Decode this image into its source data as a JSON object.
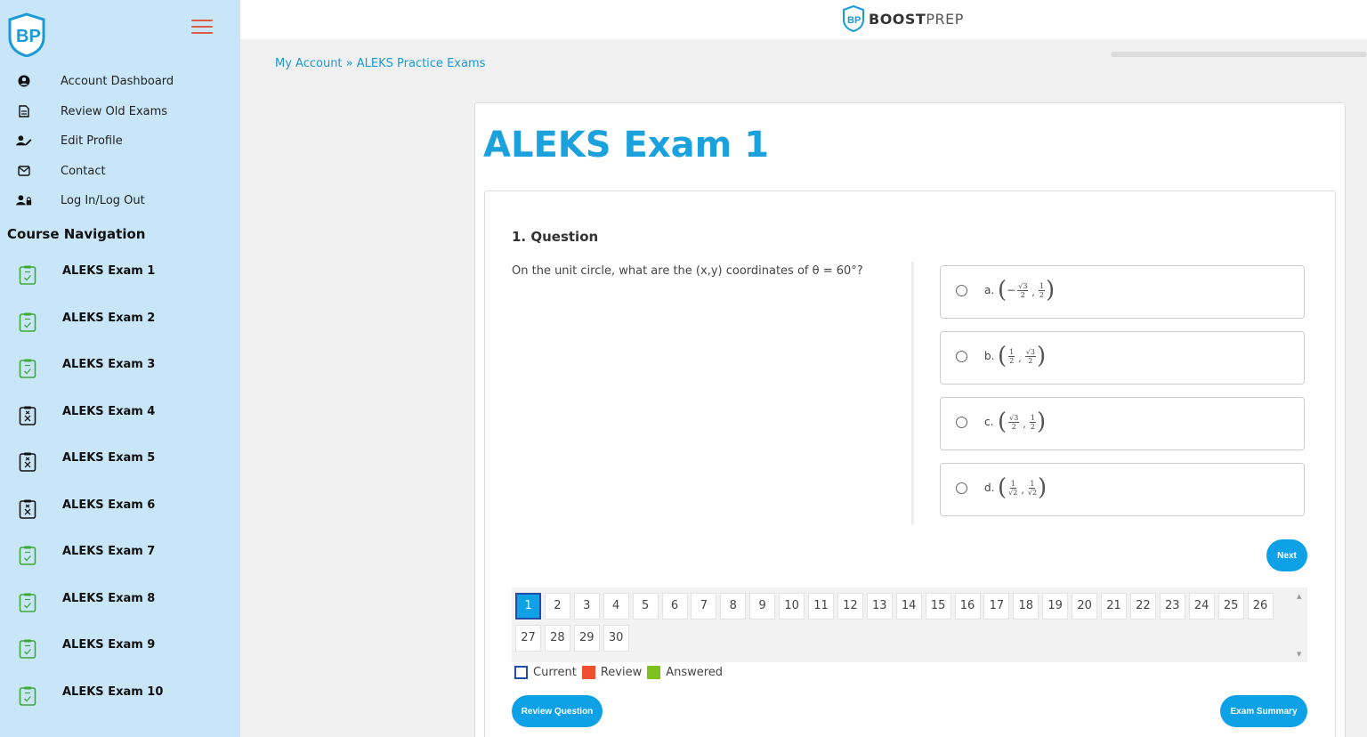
{
  "brand": {
    "name_bold": "BOOST",
    "name_light": "PREP"
  },
  "breadcrumb": {
    "home": "My Account",
    "sep": " » ",
    "current": "ALEKS Practice Exams"
  },
  "sidebar": {
    "menu": [
      {
        "label": "Account Dashboard",
        "icon": "user-circle-icon"
      },
      {
        "label": "Review Old Exams",
        "icon": "document-icon"
      },
      {
        "label": "Edit Profile",
        "icon": "user-edit-icon"
      },
      {
        "label": "Contact",
        "icon": "envelope-icon"
      },
      {
        "label": "Log In/Log Out",
        "icon": "user-lock-icon"
      }
    ],
    "course_nav_title": "Course Navigation",
    "exams": [
      {
        "label": "ALEKS Exam 1",
        "status": "passed"
      },
      {
        "label": "ALEKS Exam 2",
        "status": "passed"
      },
      {
        "label": "ALEKS Exam 3",
        "status": "passed"
      },
      {
        "label": "ALEKS Exam 4",
        "status": "failed"
      },
      {
        "label": "ALEKS Exam 5",
        "status": "failed"
      },
      {
        "label": "ALEKS Exam 6",
        "status": "failed"
      },
      {
        "label": "ALEKS Exam 7",
        "status": "passed"
      },
      {
        "label": "ALEKS Exam 8",
        "status": "passed"
      },
      {
        "label": "ALEKS Exam 9",
        "status": "passed"
      },
      {
        "label": "ALEKS Exam 10",
        "status": "passed"
      }
    ]
  },
  "exam": {
    "title": "ALEKS Exam 1",
    "question_number": "1. Question",
    "question_text": "On the unit circle, what are the (x,y) coordinates of θ = 60°?",
    "options": [
      {
        "letter": "a.",
        "x_neg": "−",
        "x_num": "√3",
        "x_den": "2",
        "y_num": "1",
        "y_den": "2"
      },
      {
        "letter": "b.",
        "x_neg": "",
        "x_num": "1",
        "x_den": "2",
        "y_num": "√3",
        "y_den": "2"
      },
      {
        "letter": "c.",
        "x_neg": "",
        "x_num": "√3",
        "x_den": "2",
        "y_num": "1",
        "y_den": "2"
      },
      {
        "letter": "d.",
        "x_neg": "",
        "x_num": "1",
        "x_den": "√2",
        "y_num": "1",
        "y_den": "√2"
      }
    ],
    "next_label": "Next",
    "review_label": "Review Question",
    "summary_label": "Exam Summary",
    "current_question": 1,
    "question_numbers": [
      "1",
      "2",
      "3",
      "4",
      "5",
      "6",
      "7",
      "8",
      "9",
      "10",
      "11",
      "12",
      "13",
      "14",
      "15",
      "16",
      "17",
      "18",
      "19",
      "20",
      "21",
      "22",
      "23",
      "24",
      "25",
      "26",
      "27",
      "28",
      "29",
      "30"
    ]
  },
  "legend": [
    {
      "label": "Current",
      "color": "#ffffff",
      "border": "#1f4ea8"
    },
    {
      "label": "Review",
      "color": "#f0502f",
      "border": "#f0502f"
    },
    {
      "label": "Answered",
      "color": "#7dc21e",
      "border": "#7dc21e"
    }
  ],
  "colors": {
    "accent": "#0ea1e6",
    "title": "#1ba2dd",
    "sidebar_bg": "#c8e6f8",
    "icon_green": "#3aaa35"
  }
}
